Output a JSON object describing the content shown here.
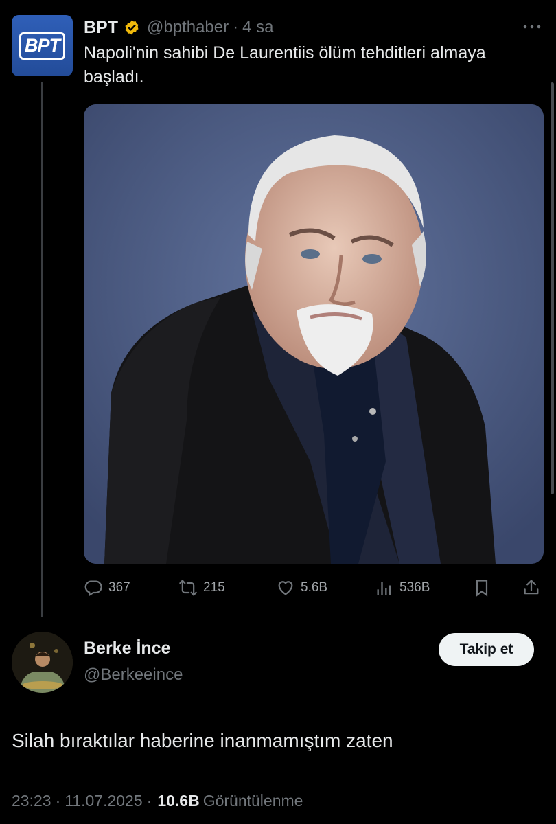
{
  "quoted_tweet": {
    "author_name": "BPT",
    "avatar_logo_text": "BPT",
    "handle": "@bpthaber",
    "separator": "·",
    "time": "4 sa",
    "text": "Napoli'nin sahibi De Laurentiis ölüm tehditleri almaya başladı.",
    "actions": {
      "replies": "367",
      "retweets": "215",
      "likes": "5.6B",
      "views": "536B"
    },
    "icons": [
      "verified-badge-icon",
      "more-icon",
      "reply-icon",
      "retweet-icon",
      "like-icon",
      "views-icon",
      "bookmark-icon",
      "share-icon"
    ],
    "verified_color": "#f0b90b"
  },
  "main_tweet": {
    "author_name": "Berke İnce",
    "handle": "@Berkeeince",
    "follow_label": "Takip et",
    "text": "Silah bıraktılar haberine inanmamıştım zaten",
    "time": "23:23",
    "separator": "·",
    "date": "11.07.2025",
    "views_count": "10.6B",
    "views_label": "Görüntülenme"
  },
  "colors": {
    "background": "#000000",
    "text": "#e7e9ea",
    "muted": "#71767b",
    "brand_blue": "#2f5fb8"
  }
}
